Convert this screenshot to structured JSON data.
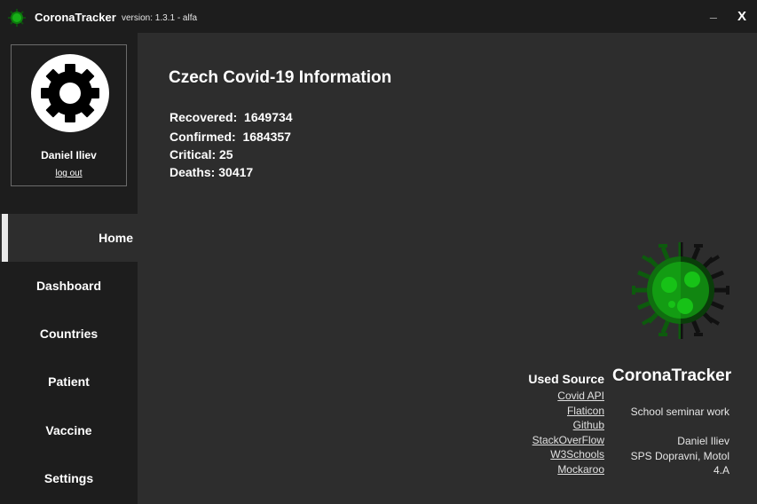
{
  "titlebar": {
    "app_name": "CoronaTracker",
    "version": "version: 1.3.1 - alfa",
    "minimize_label": "_",
    "close_label": "X",
    "app_icon": "virus-icon"
  },
  "profile": {
    "avatar_icon": "gear-icon",
    "user_name": "Daniel Iliev",
    "logout_label": "log out"
  },
  "nav": {
    "items": [
      {
        "label": "Home"
      },
      {
        "label": "Dashboard"
      },
      {
        "label": "Countries"
      },
      {
        "label": "Patient"
      },
      {
        "label": "Vaccine"
      },
      {
        "label": "Settings"
      }
    ],
    "active": "Home"
  },
  "main": {
    "title": "Czech Covid-19 Information",
    "stats": [
      {
        "label": "Recovered:",
        "value": "1649734"
      },
      {
        "label": "Confirmed:",
        "value": "1684357"
      },
      {
        "label": "Critical:",
        "value": "25"
      },
      {
        "label": "Deaths:",
        "value": "30417"
      }
    ]
  },
  "footer": {
    "logo_icon": "virus-icon",
    "used_source_title": "Used Source",
    "sources": [
      "Covid API",
      "Flaticon",
      "Github",
      "StackOverFlow",
      "W3Schools",
      "Mockaroo"
    ],
    "brand_name": "CoronaTracker",
    "description": "School seminar work",
    "author": "Daniel Iliev",
    "school": "SPS Dopravni, Motol",
    "class": "4.A"
  },
  "colors": {
    "background": "#2d2d2d",
    "sidebar": "#1d1d1d",
    "accent_green": "#17c217",
    "text": "#ffffff"
  }
}
